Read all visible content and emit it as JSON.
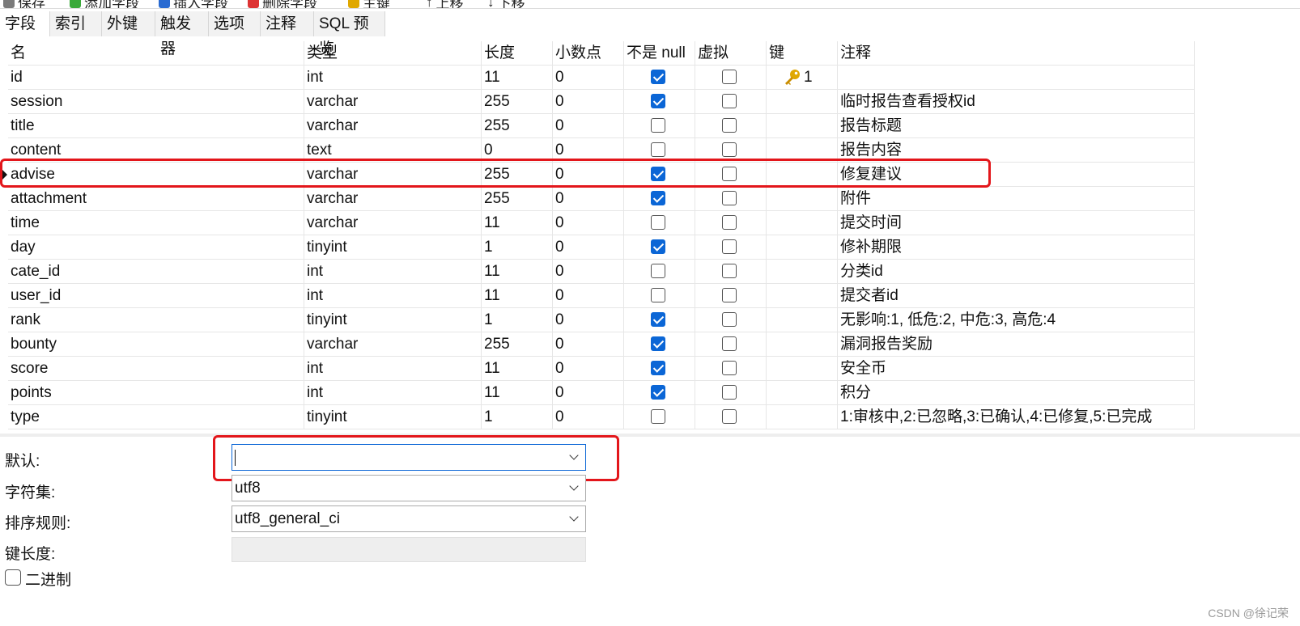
{
  "toolbar": {
    "items": [
      "保存",
      "添加字段",
      "插入字段",
      "删除字段",
      "主键",
      "上移",
      "下移"
    ]
  },
  "tabs": [
    "字段",
    "索引",
    "外键",
    "触发器",
    "选项",
    "注释",
    "SQL 预览"
  ],
  "columns": [
    "名",
    "类型",
    "长度",
    "小数点",
    "不是 null",
    "虚拟",
    "键",
    "注释"
  ],
  "rows": [
    {
      "name": "id",
      "type": "int",
      "length": "11",
      "decimals": "0",
      "not_null": true,
      "virtual": false,
      "key": "1",
      "comment": ""
    },
    {
      "name": "session",
      "type": "varchar",
      "length": "255",
      "decimals": "0",
      "not_null": true,
      "virtual": false,
      "key": "",
      "comment": "临时报告查看授权id"
    },
    {
      "name": "title",
      "type": "varchar",
      "length": "255",
      "decimals": "0",
      "not_null": false,
      "virtual": false,
      "key": "",
      "comment": "报告标题"
    },
    {
      "name": "content",
      "type": "text",
      "length": "0",
      "decimals": "0",
      "not_null": false,
      "virtual": false,
      "key": "",
      "comment": "报告内容"
    },
    {
      "name": "advise",
      "type": "varchar",
      "length": "255",
      "decimals": "0",
      "not_null": true,
      "virtual": false,
      "key": "",
      "comment": "修复建议"
    },
    {
      "name": "attachment",
      "type": "varchar",
      "length": "255",
      "decimals": "0",
      "not_null": true,
      "virtual": false,
      "key": "",
      "comment": "附件"
    },
    {
      "name": "time",
      "type": "varchar",
      "length": "11",
      "decimals": "0",
      "not_null": false,
      "virtual": false,
      "key": "",
      "comment": "提交时间"
    },
    {
      "name": "day",
      "type": "tinyint",
      "length": "1",
      "decimals": "0",
      "not_null": true,
      "virtual": false,
      "key": "",
      "comment": "修补期限"
    },
    {
      "name": "cate_id",
      "type": "int",
      "length": "11",
      "decimals": "0",
      "not_null": false,
      "virtual": false,
      "key": "",
      "comment": "分类id"
    },
    {
      "name": "user_id",
      "type": "int",
      "length": "11",
      "decimals": "0",
      "not_null": false,
      "virtual": false,
      "key": "",
      "comment": "提交者id"
    },
    {
      "name": "rank",
      "type": "tinyint",
      "length": "1",
      "decimals": "0",
      "not_null": true,
      "virtual": false,
      "key": "",
      "comment": "无影响:1, 低危:2, 中危:3, 高危:4"
    },
    {
      "name": "bounty",
      "type": "varchar",
      "length": "255",
      "decimals": "0",
      "not_null": true,
      "virtual": false,
      "key": "",
      "comment": "漏洞报告奖励"
    },
    {
      "name": "score",
      "type": "int",
      "length": "11",
      "decimals": "0",
      "not_null": true,
      "virtual": false,
      "key": "",
      "comment": "安全币"
    },
    {
      "name": "points",
      "type": "int",
      "length": "11",
      "decimals": "0",
      "not_null": true,
      "virtual": false,
      "key": "",
      "comment": "积分"
    },
    {
      "name": "type",
      "type": "tinyint",
      "length": "1",
      "decimals": "0",
      "not_null": false,
      "virtual": false,
      "key": "",
      "comment": "1:审核中,2:已忽略,3:已确认,4:已修复,5:已完成"
    }
  ],
  "selected_row": "advise",
  "props": {
    "default_label": "默认:",
    "default_value": "",
    "charset_label": "字符集:",
    "charset_value": "utf8",
    "collation_label": "排序规则:",
    "collation_value": "utf8_general_ci",
    "keylen_label": "键长度:",
    "binary_label": "二进制"
  },
  "icons": {
    "key": "key-icon",
    "dropdown": "chevron-down-icon"
  },
  "colors": {
    "highlight": "#e3161b",
    "checkbox": "#0b66d6"
  },
  "watermark": "CSDN @徐记荣"
}
